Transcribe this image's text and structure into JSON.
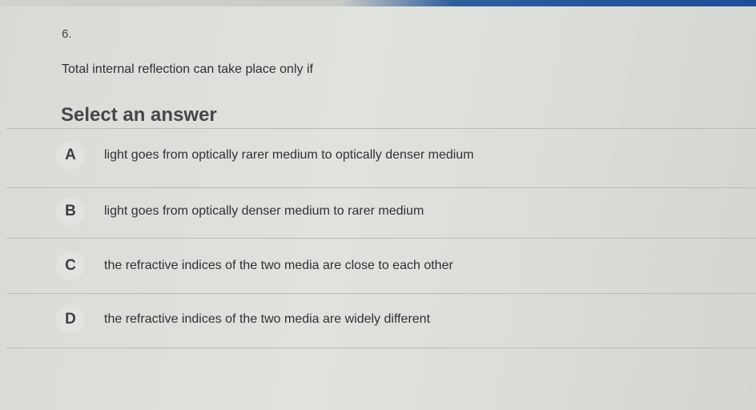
{
  "question": {
    "number": "6.",
    "text": "Total internal reflection can take place only if"
  },
  "prompt": "Select an answer",
  "options": [
    {
      "letter": "A",
      "text": "light goes from optically rarer medium to optically denser medium"
    },
    {
      "letter": "B",
      "text": "light goes from optically denser medium to rarer medium"
    },
    {
      "letter": "C",
      "text": "the refractive indices of the two media are close to each other"
    },
    {
      "letter": "D",
      "text": "the refractive indices of the two media are widely different"
    }
  ],
  "colors": {
    "accent": "#1c4f9a",
    "background": "#dcdedb",
    "divider": "#b9bbb8"
  }
}
